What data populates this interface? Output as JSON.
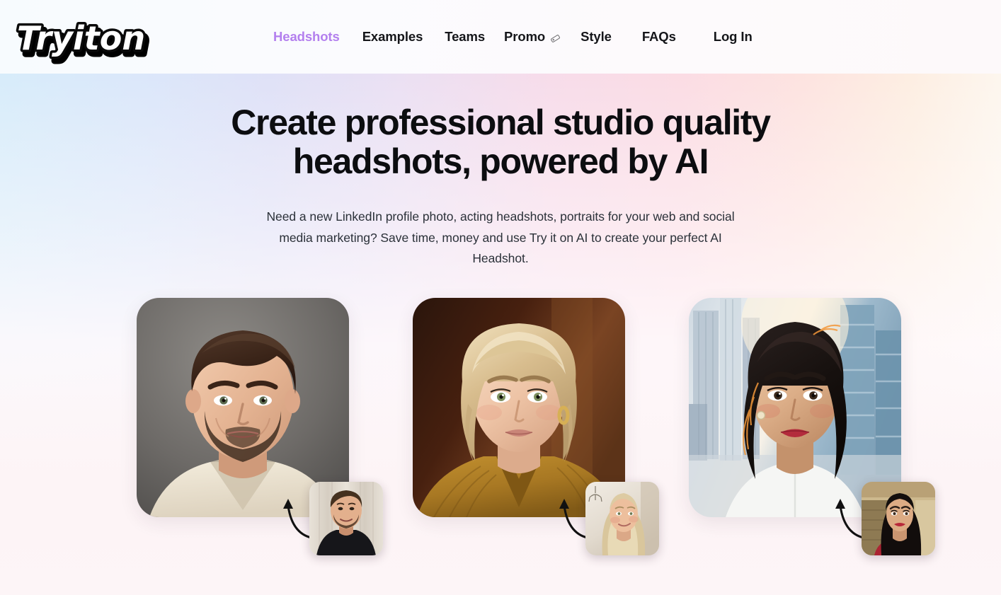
{
  "brand": {
    "logo_text": "Try it on",
    "logo_name": "try-it-on-logo"
  },
  "nav": {
    "items": [
      {
        "label": "Headshots",
        "active": true,
        "icon": null
      },
      {
        "label": "Examples",
        "active": false,
        "icon": null
      },
      {
        "label": "Teams",
        "active": false,
        "icon": null
      },
      {
        "label": "Promo",
        "active": false,
        "icon": "tag-icon"
      },
      {
        "label": "Style",
        "active": false,
        "icon": null
      },
      {
        "label": "FAQs",
        "active": false,
        "icon": null
      },
      {
        "label": "Log In",
        "active": false,
        "icon": null
      }
    ],
    "active_color": "#b37fee",
    "default_color": "#15161a"
  },
  "hero": {
    "title_line1": "Create professional studio quality",
    "title_line2": "headshots, powered by AI",
    "subtitle": "Need a new LinkedIn profile photo, acting headshots, portraits for your web and social media marketing? Save time, money and use Try it on AI to create your perfect AI Headshot.",
    "title_color": "#0c0d10",
    "subtitle_color": "#2b3139"
  },
  "showcase": {
    "cards": [
      {
        "id": "card-man-beard",
        "result_alt": "Professional headshot of smiling man with brown hair, beard and cream collared shirt on grey studio backdrop",
        "source_alt": "Original selfie of man in black t-shirt against white curtain"
      },
      {
        "id": "card-blonde-woman",
        "result_alt": "Professional headshot of blonde woman in mustard blouse with gold earring on dark warm backdrop",
        "source_alt": "Original selfie of blonde woman indoors with light wall"
      },
      {
        "id": "card-dark-hair-woman",
        "result_alt": "Professional headshot of woman with long dark hair and red lipstick in white top with city skyline backdrop",
        "source_alt": "Original selfie of woman with dark hair and red lipstick indoors"
      }
    ]
  },
  "theme": {
    "background_gradient": [
      "#d7ecfa",
      "#dfe1f7",
      "#f7dcea",
      "#fdeee2",
      "#fdf5f7"
    ],
    "header_background": "#fbfafd"
  }
}
